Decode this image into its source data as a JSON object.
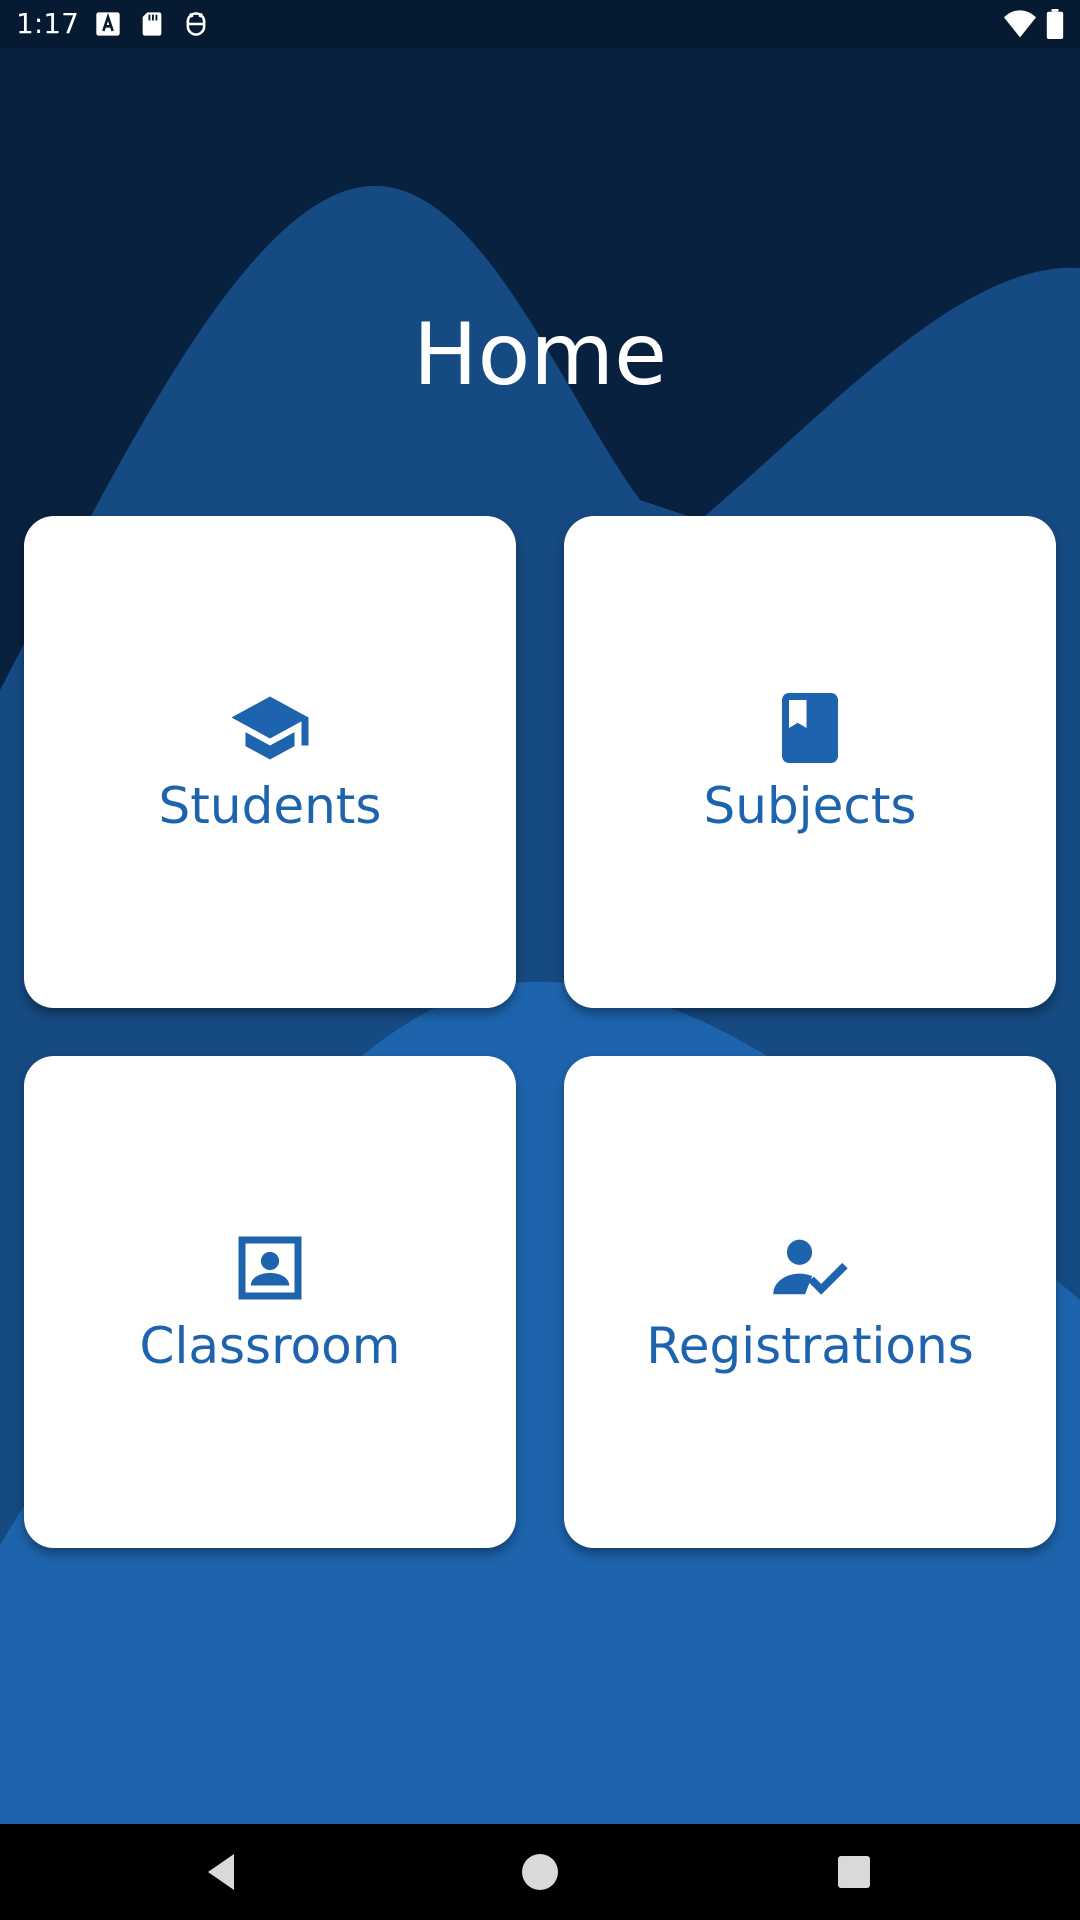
{
  "status_bar": {
    "time": "1:17",
    "icons": [
      "text-a-notification-icon",
      "sd-card-icon",
      "robot-notification-icon"
    ],
    "right_icons": [
      "wifi-icon",
      "battery-icon"
    ]
  },
  "header": {
    "title": "Home"
  },
  "menu": {
    "cards": [
      {
        "label": "Students",
        "icon": "graduation-cap-icon"
      },
      {
        "label": "Subjects",
        "icon": "book-icon"
      },
      {
        "label": "Classroom",
        "icon": "portrait-contact-icon"
      },
      {
        "label": "Registrations",
        "icon": "person-check-icon"
      }
    ]
  },
  "nav_bar": {
    "buttons": [
      "back-icon",
      "home-icon",
      "recents-icon"
    ]
  },
  "colors": {
    "background_dark": "#08213f",
    "wave_mid": "#164a82",
    "wave_light": "#1d64ad",
    "accent": "#1e63ad",
    "card": "#ffffff"
  }
}
